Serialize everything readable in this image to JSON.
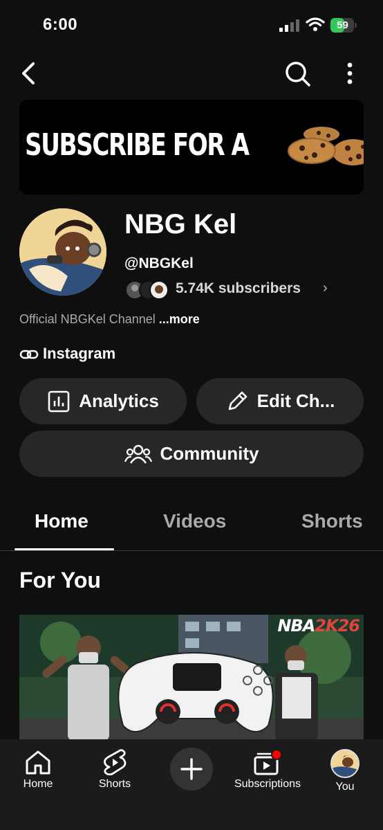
{
  "status_bar": {
    "time": "6:00",
    "battery": "59",
    "battery_level": 0.59
  },
  "banner": {
    "text": "SUBSCRIBE FOR A"
  },
  "channel": {
    "name": "NBG Kel",
    "handle": "@NBGKel",
    "subscribers": "5.74K subscribers",
    "description": "Official NBGKel Channel",
    "more_label": "...more",
    "link_label": "Instagram"
  },
  "actions": {
    "analytics": "Analytics",
    "edit": "Edit Ch...",
    "community": "Community"
  },
  "tabs": [
    {
      "label": "Home",
      "selected": true
    },
    {
      "label": "Videos",
      "selected": false
    },
    {
      "label": "Shorts",
      "selected": false
    }
  ],
  "section": {
    "title": "For You"
  },
  "thumbnail": {
    "logo_prefix": "NBA",
    "logo_suffix": "2K26"
  },
  "bottom_nav": [
    {
      "label": "Home",
      "icon": "home-icon"
    },
    {
      "label": "Shorts",
      "icon": "shorts-icon"
    },
    {
      "label": "",
      "icon": "plus-icon"
    },
    {
      "label": "Subscriptions",
      "icon": "subscriptions-icon"
    },
    {
      "label": "You",
      "icon": "avatar"
    }
  ],
  "colors": {
    "background": "#0f0f0f",
    "pill": "#272727",
    "battery_green": "#34c759",
    "notification": "#ff0000"
  }
}
